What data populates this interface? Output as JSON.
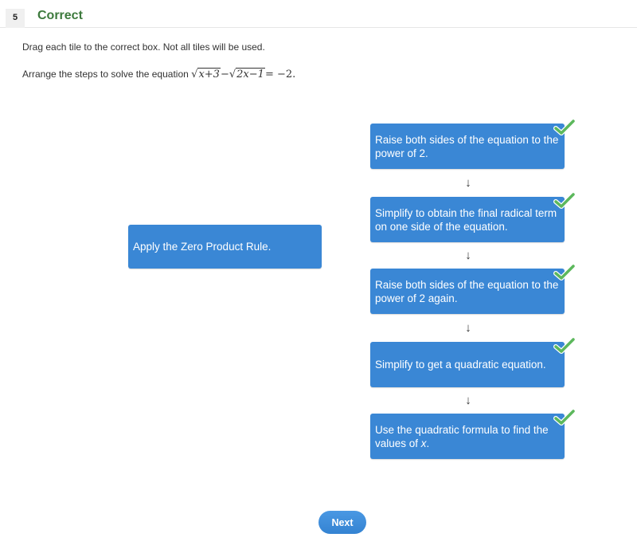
{
  "header": {
    "question_number": "5",
    "status": "Correct",
    "status_color": "#3d7a3d"
  },
  "instructions": "Drag each tile to the correct box. Not all tiles will be used.",
  "prompt": {
    "text": "Arrange the steps to solve the equation",
    "equation": {
      "radicand1": "x+3",
      "minus": "−",
      "radicand2": "2x−1",
      "rhs": "= −2",
      "sqrt": "√"
    },
    "end": "."
  },
  "unused_tiles": [
    {
      "label": "Apply the Zero Product Rule."
    }
  ],
  "answer_boxes": [
    {
      "label": "Raise both sides of the equation to the power of 2.",
      "state": "correct"
    },
    {
      "label": "Simplify to obtain the final radical term on one side of the equation.",
      "state": "correct"
    },
    {
      "label": "Raise both sides of the equation to the power of 2 again.",
      "state": "correct"
    },
    {
      "label": "Simplify to get a quadratic equation.",
      "state": "correct"
    },
    {
      "label_pre": "Use the quadratic formula to find the values of ",
      "label_var": "x",
      "label_post": ".",
      "state": "correct"
    }
  ],
  "arrow_glyph": "↓",
  "tile_color": "#3a87d5",
  "check_color": "#5cb85c",
  "next_button": {
    "label": "Next"
  }
}
